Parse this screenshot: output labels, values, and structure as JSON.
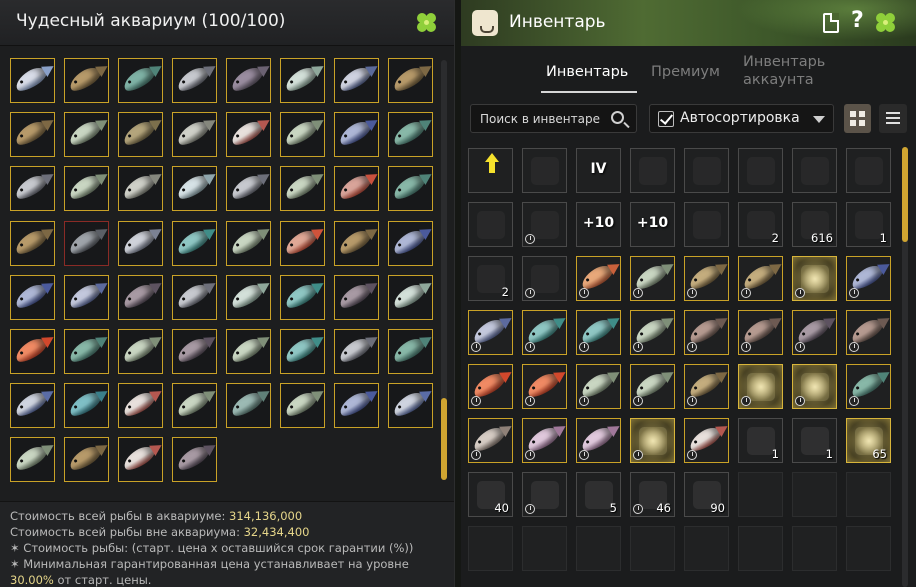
{
  "aquarium": {
    "title": "Чудесный аквариум (100/100)",
    "icon": "clover-icon",
    "fish": [
      {
        "color": "#d8dce8",
        "fin": "#8aa0c8",
        "red": false
      },
      {
        "color": "#b79a6a",
        "fin": "#7d6844",
        "red": false
      },
      {
        "color": "#7fb3a6",
        "fin": "#4f8378",
        "red": false
      },
      {
        "color": "#c7c9cf",
        "fin": "#6d6f7a",
        "red": false
      },
      {
        "color": "#9a8da0",
        "fin": "#6b6272",
        "red": false
      },
      {
        "color": "#d3e0d9",
        "fin": "#8fa89b",
        "red": false
      },
      {
        "color": "#cfd2e0",
        "fin": "#5b6a9a",
        "red": false
      },
      {
        "color": "#b79a6a",
        "fin": "#7d6844",
        "red": false
      },
      {
        "color": "#b79a6a",
        "fin": "#7d6844",
        "red": false
      },
      {
        "color": "#c9d6c2",
        "fin": "#7f8f78",
        "red": false
      },
      {
        "color": "#b4a57c",
        "fin": "#7c6f4c",
        "red": false
      },
      {
        "color": "#cfd0c8",
        "fin": "#85877d",
        "red": false
      },
      {
        "color": "#e8e0dc",
        "fin": "#b45850",
        "red": false
      },
      {
        "color": "#c9d6c2",
        "fin": "#7f8f78",
        "red": false
      },
      {
        "color": "#aeb7d6",
        "fin": "#4b5a9c",
        "red": false
      },
      {
        "color": "#88b8a8",
        "fin": "#4f8378",
        "red": false
      },
      {
        "color": "#c7c9cf",
        "fin": "#6d6f7a",
        "red": false
      },
      {
        "color": "#c9d6c2",
        "fin": "#7f8f78",
        "red": false
      },
      {
        "color": "#cfd0c8",
        "fin": "#85877d",
        "red": false
      },
      {
        "color": "#d6e2e6",
        "fin": "#8fa6ad",
        "red": false
      },
      {
        "color": "#c7c9cf",
        "fin": "#6d6f7a",
        "red": false
      },
      {
        "color": "#c9d6c2",
        "fin": "#7f8f78",
        "red": false
      },
      {
        "color": "#d9a49a",
        "fin": "#c9513e",
        "red": false
      },
      {
        "color": "#88b8a8",
        "fin": "#4f8378",
        "red": false
      },
      {
        "color": "#b79a6a",
        "fin": "#7d6844",
        "red": false
      },
      {
        "color": "#9fa4aa",
        "fin": "#5b5f66",
        "red": true
      },
      {
        "color": "#cfd2da",
        "fin": "#7c8293",
        "red": false
      },
      {
        "color": "#8fc7c4",
        "fin": "#3f8d88",
        "red": false
      },
      {
        "color": "#c9d6c2",
        "fin": "#7f8f78",
        "red": false
      },
      {
        "color": "#e0a896",
        "fin": "#d0533b",
        "red": false
      },
      {
        "color": "#b79a6a",
        "fin": "#7d6844",
        "red": false
      },
      {
        "color": "#aeb7d6",
        "fin": "#4b5a9c",
        "red": false
      },
      {
        "color": "#aeb7d6",
        "fin": "#4b5a9c",
        "red": false
      },
      {
        "color": "#c3c8dd",
        "fin": "#5c6a9e",
        "red": false
      },
      {
        "color": "#a89aa4",
        "fin": "#5d5260",
        "red": false
      },
      {
        "color": "#c7c9cf",
        "fin": "#6d6f7a",
        "red": false
      },
      {
        "color": "#d3e0d9",
        "fin": "#8fa89b",
        "red": false
      },
      {
        "color": "#8fc7c4",
        "fin": "#3f8d88",
        "red": false
      },
      {
        "color": "#a89aa4",
        "fin": "#5d5260",
        "red": false
      },
      {
        "color": "#d3e0d9",
        "fin": "#8fa89b",
        "red": false
      },
      {
        "color": "#f08a64",
        "fin": "#d2482c",
        "red": false
      },
      {
        "color": "#88b8a8",
        "fin": "#4f8378",
        "red": false
      },
      {
        "color": "#c9d6c2",
        "fin": "#7f8f78",
        "red": false
      },
      {
        "color": "#a89aa4",
        "fin": "#5d5260",
        "red": false
      },
      {
        "color": "#c9d6c2",
        "fin": "#7f8f78",
        "red": false
      },
      {
        "color": "#8fc7c4",
        "fin": "#3f8d88",
        "red": false
      },
      {
        "color": "#c7c9cf",
        "fin": "#6d6f7a",
        "red": false
      },
      {
        "color": "#88b8a8",
        "fin": "#4f8378",
        "red": false
      },
      {
        "color": "#cfd4e0",
        "fin": "#5a6ca6",
        "red": false
      },
      {
        "color": "#7fbfc6",
        "fin": "#3a7f8a",
        "red": false
      },
      {
        "color": "#e8e0dc",
        "fin": "#b45850",
        "red": false
      },
      {
        "color": "#c9d6c2",
        "fin": "#7f8f78",
        "red": false
      },
      {
        "color": "#9cbab4",
        "fin": "#5f7f78",
        "red": false
      },
      {
        "color": "#c9d6c2",
        "fin": "#7f8f78",
        "red": false
      },
      {
        "color": "#aeb7d6",
        "fin": "#4b5a9c",
        "red": false
      },
      {
        "color": "#cfd4e0",
        "fin": "#5a6ca6",
        "red": false
      },
      {
        "color": "#c9d6c2",
        "fin": "#7f8f78",
        "red": false
      },
      {
        "color": "#b79a6a",
        "fin": "#7d6844",
        "red": false
      },
      {
        "color": "#e8e0dc",
        "fin": "#b45850",
        "red": false
      },
      {
        "color": "#a89aa4",
        "fin": "#5d5260",
        "red": false
      }
    ],
    "footer": {
      "line1_label": "Стоимость всей рыбы в аквариуме:",
      "line1_value": "314,136,000",
      "line2_label": "Стоимость всей рыбы вне аквариума:",
      "line2_value": "32,434,400",
      "line3": "✶ Стоимость рыбы: (старт. цена x оставшийся срок гарантии (%))",
      "line4": "✶ Минимальная гарантированная цена устанавливает на уровне",
      "line5_value": "30.00%",
      "line5_rest": "от старт. цены."
    }
  },
  "inventory": {
    "title": "Инвентарь",
    "icons": {
      "logo": "bag-icon",
      "doc": "document-icon",
      "help": "?",
      "clover": "clover-icon"
    },
    "tabs": {
      "inventory": "Инвентарь",
      "premium": "Премиум",
      "account_line1": "Инвентарь",
      "account_line2": "аккаунта"
    },
    "search_placeholder": "Поиск в инвентаре",
    "autosort_label": "Автосортировка",
    "autosort_checked": true,
    "slots": [
      {
        "kind": "arrow"
      },
      {
        "kind": "faded"
      },
      {
        "kind": "text",
        "label": "IV"
      },
      {
        "kind": "faded"
      },
      {
        "kind": "faded"
      },
      {
        "kind": "faded"
      },
      {
        "kind": "faded"
      },
      {
        "kind": "faded"
      },
      {
        "kind": "faded"
      },
      {
        "kind": "faded",
        "clock": true
      },
      {
        "kind": "text",
        "label": "+10"
      },
      {
        "kind": "text",
        "label": "+10"
      },
      {
        "kind": "faded"
      },
      {
        "kind": "faded",
        "qty": "2"
      },
      {
        "kind": "faded",
        "qty": "616"
      },
      {
        "kind": "faded",
        "qty": "1"
      },
      {
        "kind": "faded",
        "qty": "2"
      },
      {
        "kind": "faded",
        "clock": true
      },
      {
        "kind": "fish",
        "color": "#e8a87a",
        "fin": "#c9613b",
        "clock": true
      },
      {
        "kind": "fish",
        "color": "#c9d6c2",
        "fin": "#7f8f78",
        "clock": true
      },
      {
        "kind": "fish",
        "color": "#c4ad7e",
        "fin": "#7d6844",
        "clock": true
      },
      {
        "kind": "fish",
        "color": "#c4ad7e",
        "fin": "#7d6844",
        "clock": true
      },
      {
        "kind": "sparkle",
        "clock": true
      },
      {
        "kind": "fish",
        "color": "#aeb7d6",
        "fin": "#4b5a9c",
        "clock": true
      },
      {
        "kind": "fish",
        "color": "#c3c8dd",
        "fin": "#5c6a9e",
        "clock": true
      },
      {
        "kind": "fish",
        "color": "#8fc7c4",
        "fin": "#3f8d88",
        "clock": true
      },
      {
        "kind": "fish",
        "color": "#8fc7c4",
        "fin": "#3f8d88",
        "clock": true
      },
      {
        "kind": "fish",
        "color": "#c9d6c2",
        "fin": "#7f8f78",
        "clock": true
      },
      {
        "kind": "fish",
        "color": "#b59a90",
        "fin": "#6d5a52",
        "clock": true
      },
      {
        "kind": "fish",
        "color": "#b59a90",
        "fin": "#6d5a52",
        "clock": true
      },
      {
        "kind": "fish",
        "color": "#a89aa4",
        "fin": "#5d5260",
        "clock": true
      },
      {
        "kind": "fish",
        "color": "#b59a90",
        "fin": "#6d5a52",
        "clock": true
      },
      {
        "kind": "fish",
        "color": "#f08a64",
        "fin": "#d2482c",
        "clock": true
      },
      {
        "kind": "fish",
        "color": "#f08a64",
        "fin": "#d2482c",
        "clock": true
      },
      {
        "kind": "fish",
        "color": "#c9d6c2",
        "fin": "#7f8f78",
        "clock": true
      },
      {
        "kind": "fish",
        "color": "#c9d6c2",
        "fin": "#7f8f78",
        "clock": true
      },
      {
        "kind": "fish",
        "color": "#c4ad7e",
        "fin": "#7d6844",
        "clock": true
      },
      {
        "kind": "sparkle",
        "clock": true
      },
      {
        "kind": "sparkle",
        "clock": true
      },
      {
        "kind": "fish",
        "color": "#88b8a8",
        "fin": "#4f8378",
        "clock": true
      },
      {
        "kind": "fish",
        "color": "#d6ccc4",
        "fin": "#8f8178",
        "clock": true
      },
      {
        "kind": "fish",
        "color": "#e0c8dc",
        "fin": "#a0789a",
        "clock": true
      },
      {
        "kind": "fish",
        "color": "#e0c8dc",
        "fin": "#a0789a",
        "clock": true
      },
      {
        "kind": "sparkle",
        "clock": true
      },
      {
        "kind": "fish",
        "color": "#e8e0dc",
        "fin": "#b45850",
        "clock": true
      },
      {
        "kind": "obj",
        "qty": "1"
      },
      {
        "kind": "obj",
        "qty": "1"
      },
      {
        "kind": "sparkle",
        "qty": "65"
      },
      {
        "kind": "obj",
        "qty": "40"
      },
      {
        "kind": "obj",
        "clock": true
      },
      {
        "kind": "obj",
        "qty": "5"
      },
      {
        "kind": "obj",
        "qty": "46",
        "clock": true
      },
      {
        "kind": "obj",
        "qty": "90"
      },
      {
        "kind": "empty"
      },
      {
        "kind": "empty"
      },
      {
        "kind": "empty"
      },
      {
        "kind": "empty"
      },
      {
        "kind": "empty"
      },
      {
        "kind": "empty"
      },
      {
        "kind": "empty"
      },
      {
        "kind": "empty"
      },
      {
        "kind": "empty"
      },
      {
        "kind": "empty"
      },
      {
        "kind": "empty"
      }
    ]
  }
}
